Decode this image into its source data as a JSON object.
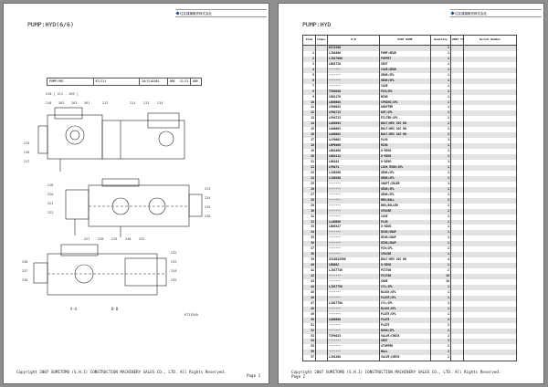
{
  "pages": [
    {
      "title": "PUMP:HYD(6/6)",
      "logo_text": "住友建機販売株式会社",
      "strip": [
        "PUMP;HYD",
        "KT/J11",
        "2A(S)A1001",
        "000",
        "11/11",
        "000"
      ],
      "ref_label": "210 [ 211 - 269 ]",
      "drawing_code": "KTJ1940",
      "section_labels": [
        "A-A",
        "B-B"
      ],
      "callouts": [
        "210",
        "262",
        "263",
        "261",
        "212",
        "211",
        "213",
        "214",
        "215",
        "216",
        "217",
        "218",
        "220",
        "221",
        "222",
        "223",
        "224",
        "225",
        "226",
        "227",
        "228",
        "229",
        "230",
        "231",
        "232",
        "233",
        "234",
        "235",
        "236",
        "237",
        "238"
      ],
      "footer": "Copyright 2007 SUMITOMO (S.H.I) CONSTRUCTION MACHINERY SALES CO., LTD. All Rights Reserved.",
      "page_label": "Page 1"
    },
    {
      "title": "PUMP:HYD",
      "logo_text": "住友建機販売株式会社",
      "footer": "Copyright 2007 SUMITOMO (S.H.I) CONSTRUCTION MACHINERY SALES CO., LTD. All Rights Reserved.",
      "page_label": "Page 2"
    }
  ],
  "table": {
    "headers": [
      "Item",
      "Compo.",
      "P/N",
      "PART NAME",
      "Quantity",
      "AMDT TYPE",
      "Serial Number"
    ],
    "rows": [
      [
        "",
        "",
        "KXJ1940",
        "",
        "1"
      ],
      [
        "1",
        "",
        "LJ01000",
        "PUMP;GEAR",
        "1"
      ],
      [
        "2",
        "",
        "LJ017000",
        "POPPET",
        "1"
      ],
      [
        "3",
        "",
        "LB01720",
        "SEAT",
        "1"
      ],
      [
        "4",
        "",
        "-------",
        "CASE;GEAR",
        "1"
      ],
      [
        "5",
        "",
        "-------",
        "GEAR;SPL",
        "1"
      ],
      [
        "6",
        "",
        "-------",
        "GEAR;SPL",
        "1"
      ],
      [
        "7",
        "",
        "-------",
        "CASE",
        "1"
      ],
      [
        "8",
        "",
        "TX00040",
        "PIN;SPL",
        "2"
      ],
      [
        "9",
        "",
        "LB01170",
        "RING",
        "1"
      ],
      [
        "10",
        "",
        "LB00000",
        "SPRING;SPL",
        "1"
      ],
      [
        "11",
        "",
        "LP00043",
        "ADAPTER",
        "1"
      ],
      [
        "12",
        "",
        "LP04713",
        "NUT;SPL",
        "1"
      ],
      [
        "13",
        "",
        "LP04713",
        "FILTER;SPL",
        "1"
      ],
      [
        "14",
        "",
        "LA00004",
        "BOLT;HEX SOC HD",
        "2"
      ],
      [
        "15",
        "",
        "LA00003",
        "BOLT;HEX SOC HD",
        "2"
      ],
      [
        "16",
        "",
        "LA00002",
        "BOLT;HEX SOC HD",
        "2"
      ],
      [
        "17",
        "",
        "LLP0001",
        "PLUG",
        "1"
      ],
      [
        "18",
        "",
        "LBP0000",
        "RING",
        "1"
      ],
      [
        "19",
        "",
        "LB01000",
        "O-RING",
        "1"
      ],
      [
        "20",
        "",
        "LB02112",
        "O-RING",
        "1"
      ],
      [
        "21",
        "",
        "LB0102",
        "O-RING",
        "1"
      ],
      [
        "22",
        "",
        "LP0474",
        "LOCK RING;SPL",
        "1"
      ],
      [
        "23",
        "",
        "LC00200",
        "GEAR;SPL",
        "1"
      ],
      [
        "24",
        "",
        "LC00200",
        "GEAR;SPL",
        "1"
      ],
      [
        "25",
        "",
        "-------",
        "SHAFT;IDLER",
        "1"
      ],
      [
        "26",
        "",
        "-------",
        "GEAR;SPL",
        "1"
      ],
      [
        "27",
        "",
        "-------",
        "GEAR;SPL",
        "1"
      ],
      [
        "28",
        "",
        "-------",
        "BRG;BALL",
        "2"
      ],
      [
        "29",
        "",
        "-------",
        "BRG;ROLLER",
        "1"
      ],
      [
        "30",
        "",
        "-------",
        "SPACER",
        "2"
      ],
      [
        "31",
        "",
        "-------",
        "CASE",
        "1"
      ],
      [
        "32",
        "",
        "LL00000",
        "PLUG",
        "1"
      ],
      [
        "33",
        "",
        "LB00347",
        "O-RING",
        "1"
      ],
      [
        "34",
        "",
        "-------",
        "RING;SNAP",
        "1"
      ],
      [
        "35",
        "",
        "-------",
        "RING;SNAP",
        "1"
      ],
      [
        "36",
        "",
        "-------",
        "RING;SNAP",
        "1"
      ],
      [
        "37",
        "",
        "-------",
        "PIN;SPL",
        "2"
      ],
      [
        "38",
        "",
        "-------",
        "SPACER",
        "1"
      ],
      [
        "39",
        "",
        "ZS18D12500",
        "BOLT;HEX SOC HD",
        "4"
      ],
      [
        "40",
        "",
        "LB0082",
        "O-RING",
        "1"
      ],
      [
        "41",
        "",
        "LJ017740",
        "PISTON",
        "2"
      ],
      [
        "42",
        "",
        "-------",
        "PISTON",
        "10"
      ],
      [
        "43",
        "",
        "-------",
        "SHOE",
        "10"
      ],
      [
        "44",
        "",
        "LJ017750",
        "CYL;SPL",
        "1"
      ],
      [
        "45",
        "",
        "-------",
        "BLOCK;SPL",
        "1"
      ],
      [
        "46",
        "",
        "-------",
        "PLATE;SPL",
        "1"
      ],
      [
        "47",
        "",
        "LJ017760",
        "CYL;SPL",
        "1"
      ],
      [
        "48",
        "",
        "-------",
        "BLOCK;SPL",
        "1"
      ],
      [
        "49",
        "",
        "-------",
        "PLATE;SPL",
        "1"
      ],
      [
        "50",
        "",
        "LA00000",
        "PLATE",
        "2"
      ],
      [
        "51",
        "",
        "-------",
        "PLATE",
        "2"
      ],
      [
        "52",
        "",
        "-------",
        "BUSH;SPL",
        "2"
      ],
      [
        "53",
        "",
        "TXP0023",
        "VALVE;CHECK",
        "2"
      ],
      [
        "54",
        "",
        "-------",
        "SEAT",
        "2"
      ],
      [
        "55",
        "",
        "-------",
        "STOPPER",
        "2"
      ],
      [
        "56",
        "",
        "-------",
        "BALL",
        "2"
      ],
      [
        "57",
        "",
        "LJ01200",
        "VALVE;CHECK",
        "2"
      ]
    ]
  }
}
